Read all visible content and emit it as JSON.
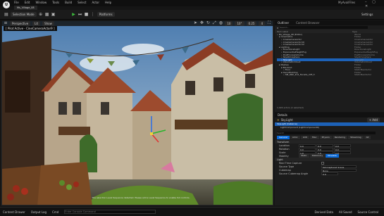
{
  "app": {
    "project_tab": "Ms_Village_08",
    "project_name": "MyAvailFiles",
    "menu": [
      "File",
      "Edit",
      "Window",
      "Tools",
      "Build",
      "Select",
      "Actor",
      "Help"
    ]
  },
  "toolbar": {
    "mode_label": "Selection Mode",
    "platforms_label": "Platforms",
    "settings_label": "Settings"
  },
  "viewport": {
    "perspective_label": "Perspective",
    "lit_label": "Lit",
    "show_label": "Show",
    "pilot_label": "[ Pilot Active - CineCameraActor9 ]",
    "grid_value": "10",
    "angle_value": "10°",
    "scale_value": "0.25",
    "speed_value": "4",
    "notice": "The selection Level Sequence detected. Please add a Level Sequence to enable full controls."
  },
  "outliner": {
    "tab_outliner": "Outliner",
    "tab_content": "Content Browser",
    "search_placeholder": "Search...",
    "col_name": "Item Label",
    "col_type": "Type",
    "status": "1,024 actors (1 selected)",
    "rows": [
      {
        "label": "Ms_Village_08 (Editor)",
        "type": "World"
      },
      {
        "label": "Cinematics",
        "type": "Folder"
      },
      {
        "label": "CineCameraActor",
        "type": "CineCameraActor"
      },
      {
        "label": "CineCameraActor10",
        "type": "CineCameraActor"
      },
      {
        "label": "CineCameraActor12",
        "type": "CineCameraActor"
      },
      {
        "label": "Lighting",
        "type": "Folder"
      },
      {
        "label": "DirectionalLight",
        "type": "DirectionalLight"
      },
      {
        "label": "ExponentialHeightFog",
        "type": "ExponentialHeightFog"
      },
      {
        "label": "PostProcessVolume",
        "type": "PostProcessVolume"
      },
      {
        "label": "SkyAtmosphere",
        "type": "SkyAtmosphere"
      },
      {
        "label": "SkyLight",
        "type": "SkyLight"
      },
      {
        "label": "VolumetricCloud",
        "type": "VolumetricCloud"
      },
      {
        "label": "Meshes",
        "type": "Folder"
      },
      {
        "label": "Blockout",
        "type": "Folder"
      },
      {
        "label": "Floor",
        "type": "StaticMeshActor"
      },
      {
        "label": "DecorBuilding",
        "type": "Folder"
      },
      {
        "label": "SM_Wall_2nd_Facade_cliff_3",
        "type": "StaticMeshActor"
      }
    ]
  },
  "details": {
    "tab": "Details",
    "actor_name": "SkyLight",
    "add_label": "+ Add",
    "component": "SkyLight (Instance)",
    "subcomponent": "LightComponent (LightComponent0)",
    "search_placeholder": "Search",
    "categories": [
      "General",
      "Actor",
      "LOD",
      "Misc",
      "Physics",
      "Rendering",
      "Streaming",
      "All"
    ],
    "transform_header": "Transform",
    "location_label": "Location",
    "rotation_label": "Rotation",
    "scale_label": "Scale",
    "location": [
      "0.0",
      "0.0",
      "0.0"
    ],
    "rotation": [
      "0.0",
      "0.0",
      "0.0"
    ],
    "scale": [
      "1.0",
      "1.0",
      "1.0"
    ],
    "mobility_label": "Mobility",
    "mobility_options": [
      "Static",
      "Stationary",
      "Movable"
    ],
    "light_header": "Light",
    "realtime_label": "Real Time Capture",
    "source_type_label": "Source Type",
    "source_type_value": "SLS Captured Scene",
    "cubemap_label": "Cubemap",
    "cubemap_value": "None",
    "angle_label": "Source Cubemap Angle",
    "angle_value": "0.0"
  },
  "bottom": {
    "content_drawer": "Content Drawer",
    "output_log": "Output Log",
    "cmd_label": "Cmd",
    "cmd_placeholder": "Enter Console Command",
    "derived_data": "Derived Data",
    "all_saved": "All Saved",
    "source_control": "Source Control"
  },
  "colors": {
    "accent": "#0a6ad8",
    "play": "#3cba3c",
    "selection": "#1d62b8"
  }
}
